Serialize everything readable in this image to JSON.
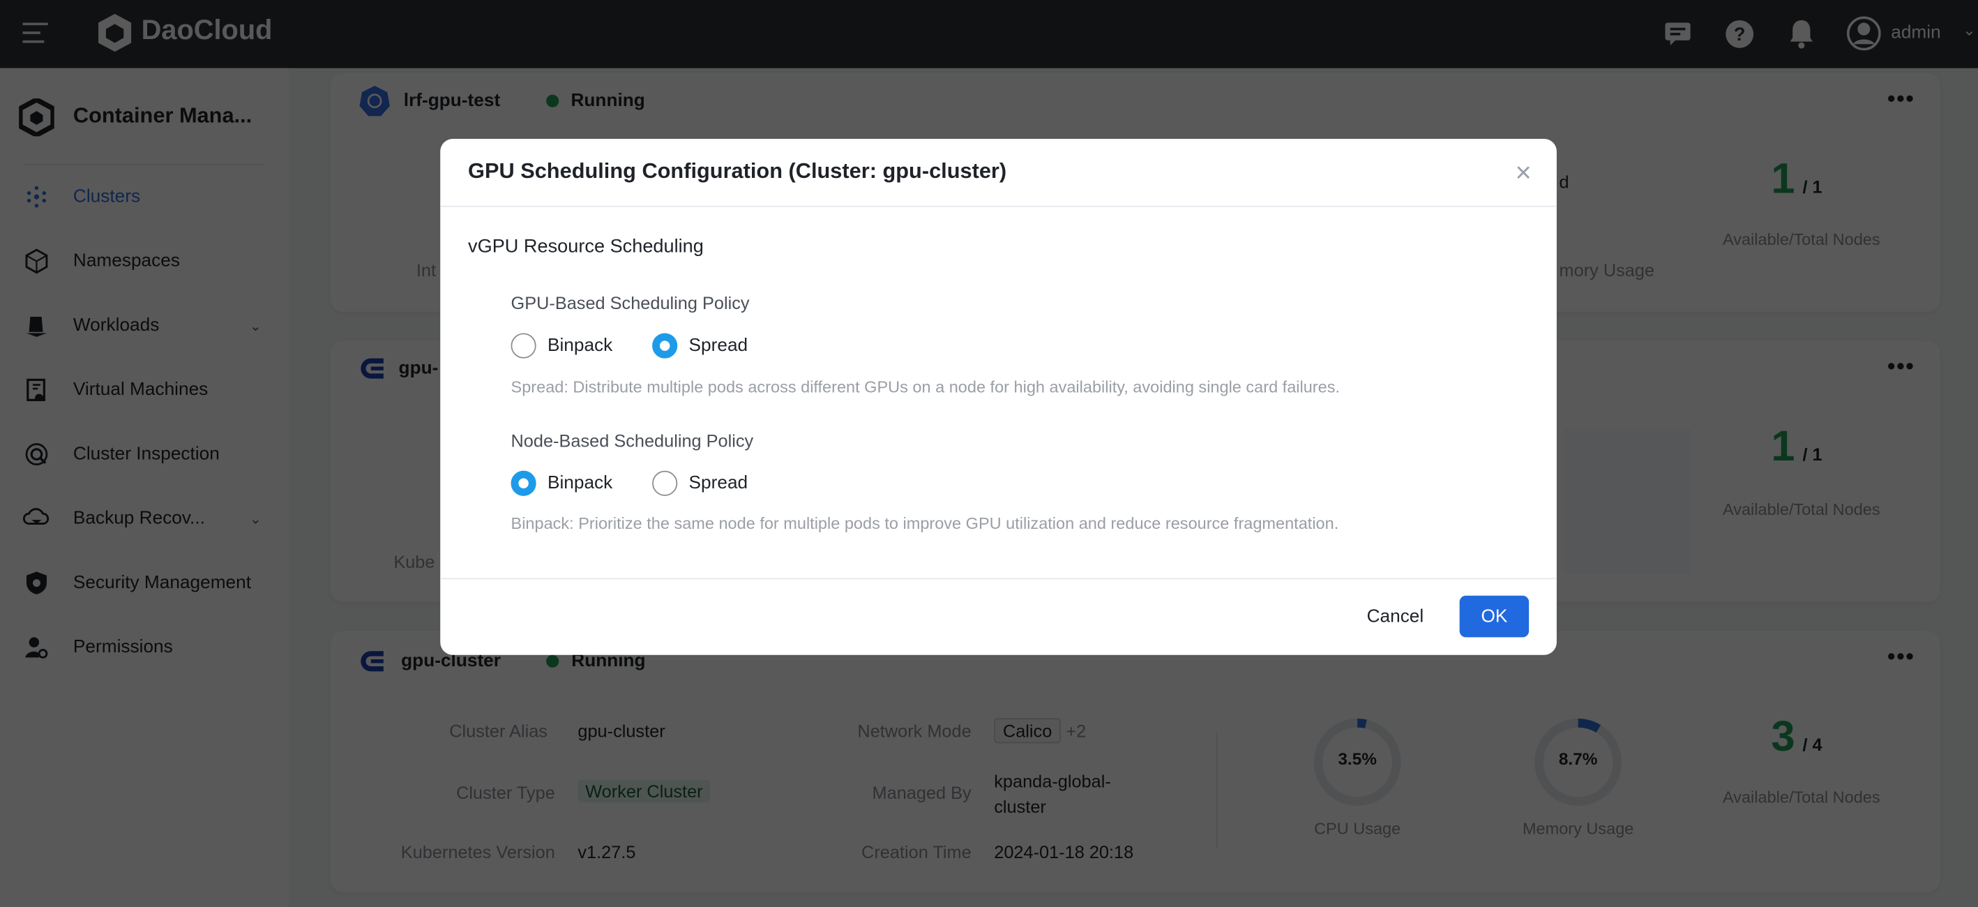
{
  "topbar": {
    "brand": "DaoCloud",
    "user": "admin"
  },
  "sidebar": {
    "title": "Container Mana...",
    "items": [
      {
        "label": "Clusters",
        "icon": "clusters-icon",
        "active": true
      },
      {
        "label": "Namespaces",
        "icon": "namespace-cube-icon"
      },
      {
        "label": "Workloads",
        "icon": "workloads-icon",
        "expandable": true
      },
      {
        "label": "Virtual Machines",
        "icon": "virtual-machine-icon"
      },
      {
        "label": "Cluster Inspection",
        "icon": "inspection-icon"
      },
      {
        "label": "Backup Recov...",
        "icon": "backup-cloud-icon",
        "expandable": true
      },
      {
        "label": "Security Management",
        "icon": "shield-gear-icon"
      },
      {
        "label": "Permissions",
        "icon": "user-gear-icon"
      }
    ]
  },
  "cards": [
    {
      "name": "lrf-gpu-test",
      "status": "Running",
      "frag_label": "Int",
      "frag_a": "d",
      "frag_b": "mory Usage",
      "avail": "1",
      "total": "/ 1",
      "nodes_label": "Available/Total Nodes"
    },
    {
      "name": "gpu-",
      "frag_label": "Kube",
      "avail": "1",
      "total": "/ 1",
      "nodes_label": "Available/Total Nodes"
    },
    {
      "name": "gpu-cluster",
      "status": "Running",
      "alias_label": "Cluster Alias",
      "alias": "gpu-cluster",
      "type_label": "Cluster Type",
      "type": "Worker Cluster",
      "k8s_label": "Kubernetes Version",
      "k8s": "v1.27.5",
      "net_label": "Network Mode",
      "net": "Calico",
      "net_more": "+2",
      "managed_label": "Managed By",
      "managed": "kpanda-global-cluster",
      "created_label": "Creation Time",
      "created": "2024-01-18 20:18",
      "cpu": "3.5%",
      "cpu_value": 3.5,
      "cpu_label": "CPU Usage",
      "mem": "8.7%",
      "mem_value": 8.7,
      "mem_label": "Memory Usage",
      "avail": "3",
      "total": "/ 4",
      "nodes_label": "Available/Total Nodes"
    }
  ],
  "modal": {
    "title": "GPU Scheduling Configuration (Cluster: gpu-cluster)",
    "section": "vGPU Resource Scheduling",
    "gpu_policy": {
      "label": "GPU-Based Scheduling Policy",
      "options": [
        "Binpack",
        "Spread"
      ],
      "selected": "Spread",
      "hint": "Spread: Distribute multiple pods across different GPUs on a node for high availability, avoiding single card failures."
    },
    "node_policy": {
      "label": "Node-Based Scheduling Policy",
      "options": [
        "Binpack",
        "Spread"
      ],
      "selected": "Binpack",
      "hint": "Binpack: Prioritize the same node for multiple pods to improve GPU utilization and reduce resource fragmentation."
    },
    "cancel": "Cancel",
    "ok": "OK"
  },
  "colors": {
    "accent": "#2f6fd6",
    "ok_button": "#2169de",
    "radio": "#1e9be8",
    "running": "#1f9d55"
  }
}
